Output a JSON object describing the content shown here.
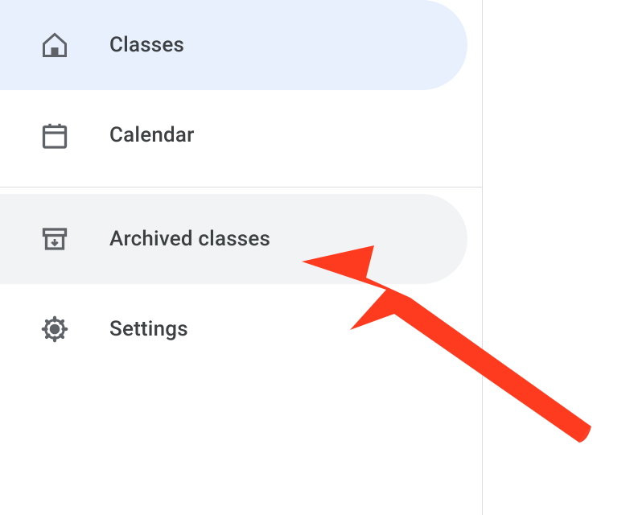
{
  "sidebar": {
    "items": [
      {
        "label": "Classes",
        "icon": "home-icon",
        "active": true
      },
      {
        "label": "Calendar",
        "icon": "calendar-icon",
        "active": false
      },
      {
        "label": "Archived classes",
        "icon": "archive-icon",
        "active": false,
        "hovered": true
      },
      {
        "label": "Settings",
        "icon": "gear-icon",
        "active": false
      }
    ]
  },
  "annotation": {
    "type": "arrow",
    "color": "#ff3b1f",
    "points_to": "sidebar-item-archived"
  }
}
